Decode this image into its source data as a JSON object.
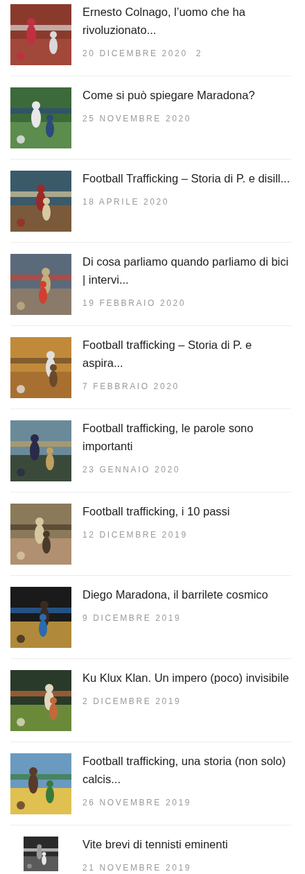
{
  "posts": [
    {
      "title": "Ernesto Colnago, l’uomo che ha rivoluzionato...",
      "date": "20 DICEMBRE 2020",
      "comments": "2"
    },
    {
      "title": "Come si può spiegare Maradona?",
      "date": "25 NOVEMBRE 2020"
    },
    {
      "title": "Football Trafficking – Storia di P. e disill...",
      "date": "18 APRILE 2020"
    },
    {
      "title": "Di cosa parliamo quando parliamo di bici | intervi...",
      "date": "19 FEBBRAIO 2020"
    },
    {
      "title": "Football trafficking – Storia di P. e aspira...",
      "date": "7 FEBBRAIO 2020"
    },
    {
      "title": "Football trafficking, le parole sono importanti",
      "date": "23 GENNAIO 2020"
    },
    {
      "title": "Football trafficking, i 10 passi",
      "date": "12 DICEMBRE 2019"
    },
    {
      "title": "Diego Maradona, il barrilete cosmico",
      "date": "9 DICEMBRE 2019"
    },
    {
      "title": "Ku Klux Klan. Un impero (poco) invisibile",
      "date": "2 DICEMBRE 2019"
    },
    {
      "title": "Football trafficking, una storia (non solo) calcis...",
      "date": "26 NOVEMBRE 2019"
    },
    {
      "title": "Vite brevi di tennisti eminenti",
      "date": "21 NOVEMBRE 2019"
    }
  ]
}
